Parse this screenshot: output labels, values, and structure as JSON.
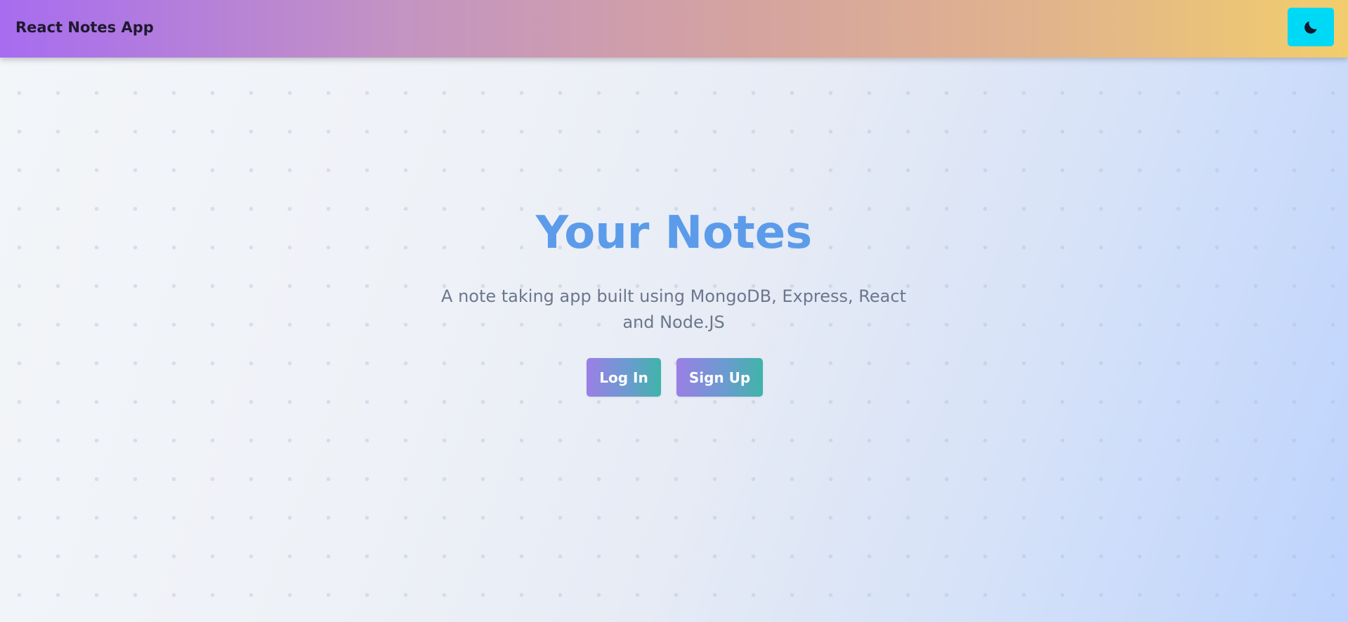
{
  "navbar": {
    "brand": "React Notes App",
    "theme_toggle_icon": "moon-icon"
  },
  "hero": {
    "title": "Your Notes",
    "subtitle": "A note taking app built using MongoDB, Express, React and Node.JS",
    "login_label": "Log In",
    "signup_label": "Sign Up"
  },
  "colors": {
    "title": "#5b9bea",
    "theme_button": "#00d9f5",
    "navbar_start": "#a76cf0",
    "navbar_end": "#f2cd6c",
    "button_start": "#9b7fe5",
    "button_end": "#3fb4a8"
  }
}
